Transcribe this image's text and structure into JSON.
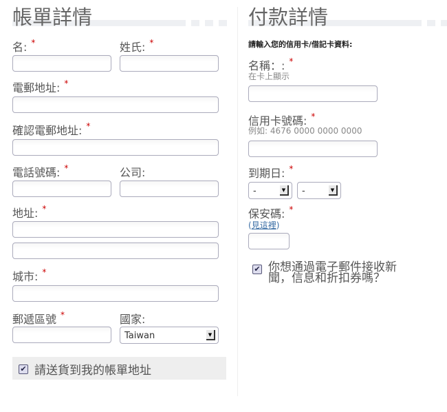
{
  "billing": {
    "title": "帳單詳情",
    "first_name": "名:",
    "last_name": "姓氏:",
    "email": "電郵地址:",
    "confirm_email": "確認電郵地址:",
    "phone": "電話號碼:",
    "company": "公司:",
    "address": "地址:",
    "city": "城市:",
    "postcode": "郵遞區號",
    "country": "國家:",
    "country_value": "Taiwan",
    "ship_same": "請送貨到我的帳單地址",
    "ship_same_checked": true
  },
  "payment": {
    "title": "付款詳情",
    "subtitle": "請輸入您的信用卡/借記卡資料:",
    "name_label": "名稱：:",
    "name_hint": "在卡上顯示",
    "card_label": "信用卡號碼:",
    "card_hint": "例如: 4676 0000 0000 0000",
    "expiry_label": "到期日:",
    "expiry_month": "-",
    "expiry_year": "-",
    "cvv_label": "保安碼:",
    "cvv_open": "(",
    "cvv_link": "見這裡",
    "cvv_close": ")",
    "newsletter": "你想通過電子郵件接收新聞，信息和折扣券嗎？",
    "newsletter_checked": true
  },
  "required_mark": "*",
  "check_mark": "✔",
  "arrow": "▼"
}
